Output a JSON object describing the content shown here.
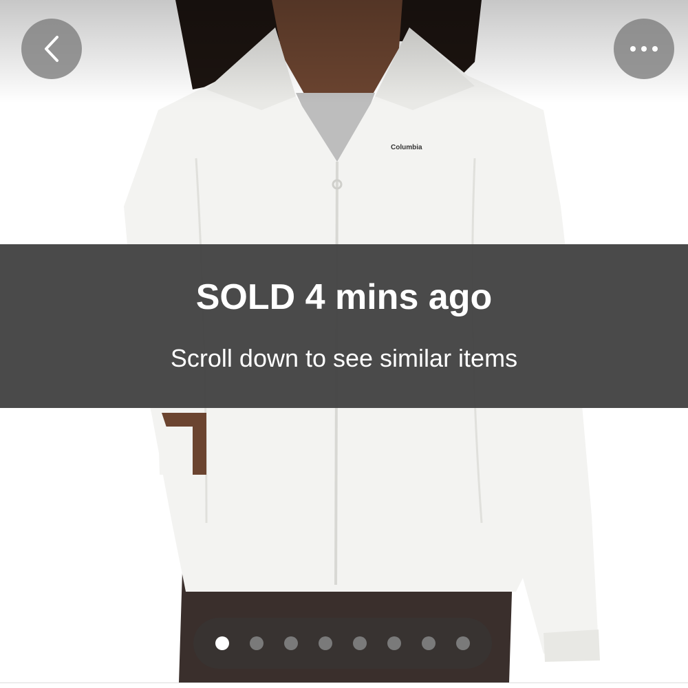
{
  "header": {
    "back_icon": "chevron-left-icon",
    "more_icon": "more-horizontal-icon"
  },
  "photo": {
    "brand_mark": "Columbia",
    "colors": {
      "fleece": "#f3f3f1",
      "undershirt": "#bdbdbd",
      "pants": "#3a2f2c",
      "skin": "#6b4430",
      "hair": "#1c1410"
    }
  },
  "banner": {
    "title": "SOLD 4 mins ago",
    "subtitle": "Scroll down to see similar items"
  },
  "pager": {
    "count": 8,
    "active_index": 0
  },
  "colors": {
    "banner_bg": "#444444",
    "button_bg": "#808080",
    "dot_active": "#ffffff",
    "dot_inactive": "#7a7a7a"
  }
}
